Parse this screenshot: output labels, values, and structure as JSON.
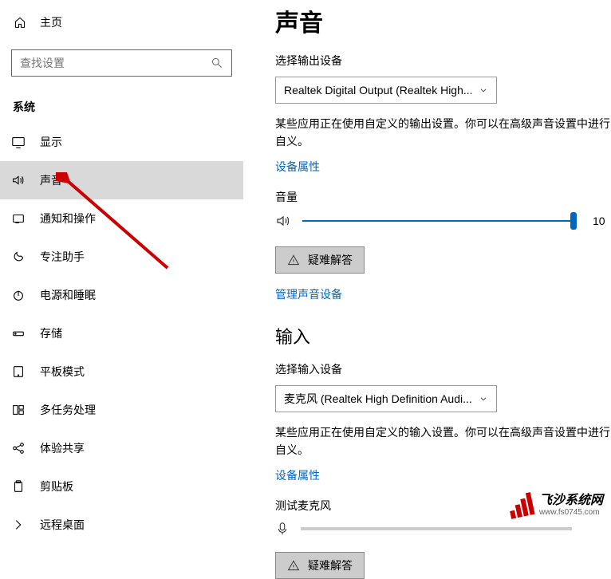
{
  "sidebar": {
    "home": "主页",
    "search_placeholder": "查找设置",
    "section": "系统",
    "items": [
      {
        "label": "显示"
      },
      {
        "label": "声音"
      },
      {
        "label": "通知和操作"
      },
      {
        "label": "专注助手"
      },
      {
        "label": "电源和睡眠"
      },
      {
        "label": "存储"
      },
      {
        "label": "平板模式"
      },
      {
        "label": "多任务处理"
      },
      {
        "label": "体验共享"
      },
      {
        "label": "剪贴板"
      },
      {
        "label": "远程桌面"
      }
    ]
  },
  "main": {
    "title": "声音",
    "output": {
      "label": "选择输出设备",
      "selected": "Realtek Digital Output (Realtek High...",
      "note": "某些应用正在使用自定义的输出设置。你可以在高级声音设置中进行自义。",
      "props_link": "设备属性"
    },
    "volume": {
      "label": "音量",
      "value": "10"
    },
    "troubleshoot": "疑难解答",
    "manage_link": "管理声音设备",
    "input": {
      "heading": "输入",
      "label": "选择输入设备",
      "selected": "麦克风 (Realtek High Definition Audi...",
      "note": "某些应用正在使用自定义的输入设置。你可以在高级声音设置中进行自义。",
      "props_link": "设备属性",
      "test_label": "测试麦克风"
    },
    "troubleshoot2": "疑难解答"
  },
  "watermark": {
    "title": "飞沙系统网",
    "url": "www.fs0745.com"
  }
}
